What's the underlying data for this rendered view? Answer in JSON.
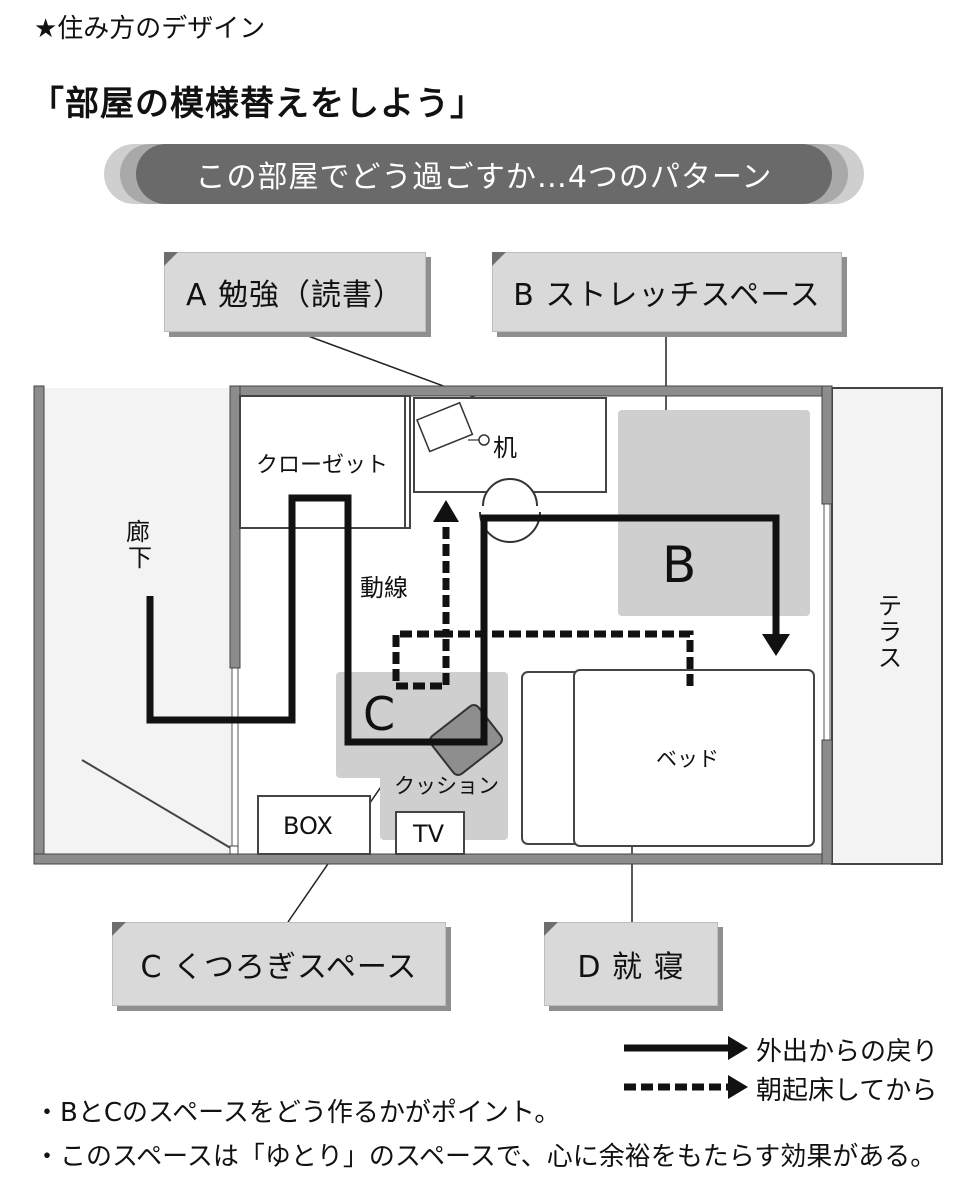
{
  "section_heading": "★住み方のデザイン",
  "title": "「部屋の模様替えをしよう」",
  "banner": "この部屋でどう過ごすか…4つのパターン",
  "callouts": {
    "a": "A 勉強（読書）",
    "b": "B ストレッチスペース",
    "c": "C くつろぎスペース",
    "d": "D 就 寝"
  },
  "room_labels": {
    "closet": "クローゼット",
    "desk": "机",
    "corridor": "廊下",
    "flow": "動線",
    "big_b": "B",
    "big_c": "C",
    "cushion": "クッション",
    "box": "BOX",
    "tv": "TV",
    "bed": "ベッド",
    "terrace": "テラス"
  },
  "legend": {
    "solid": "外出からの戻り",
    "dashed": "朝起床してから"
  },
  "notes": [
    "・BとCのスペースをどう作るかがポイント。",
    "・このスペースは「ゆとり」のスペースで、心に余裕をもたらす効果がある。"
  ]
}
